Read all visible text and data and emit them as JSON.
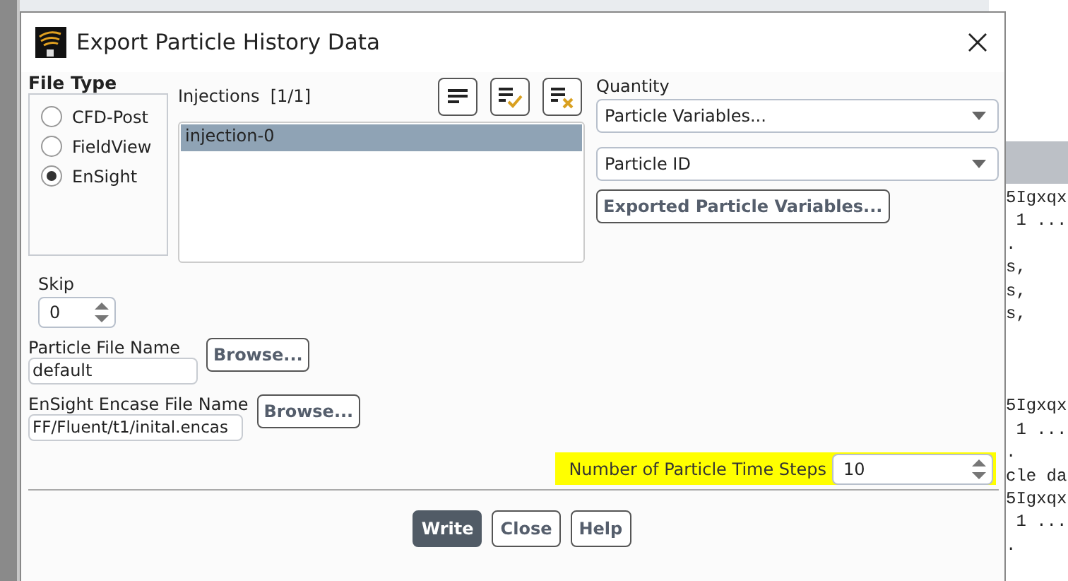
{
  "window": {
    "title": "Export Particle History Data"
  },
  "file_type": {
    "label": "File Type",
    "options": [
      {
        "label": "CFD-Post",
        "selected": false
      },
      {
        "label": "FieldView",
        "selected": false
      },
      {
        "label": "EnSight",
        "selected": true
      }
    ]
  },
  "injections": {
    "label": "Injections",
    "count": "[1/1]",
    "items": [
      {
        "label": "injection-0",
        "selected": true
      }
    ]
  },
  "quantity": {
    "label": "Quantity",
    "dropdowns": [
      {
        "value": "Particle Variables..."
      },
      {
        "value": "Particle ID"
      }
    ],
    "button": "Exported Particle Variables..."
  },
  "skip": {
    "label": "Skip",
    "value": "0"
  },
  "particle_file": {
    "label": "Particle File Name",
    "value": "default",
    "button": "Browse..."
  },
  "encase_file": {
    "label": "EnSight Encase File Name",
    "value": "FF/Fluent/t1/inital.encas",
    "button": "Browse..."
  },
  "time_steps": {
    "label": "Number of Particle Time Steps",
    "value": "10",
    "highlighted": true
  },
  "buttons": [
    {
      "label": "Write",
      "primary": true
    },
    {
      "label": "Close",
      "primary": false
    },
    {
      "label": "Help",
      "primary": false
    }
  ],
  "background_console": {
    "blocks": [
      [
        "5Igxqx",
        " 1 ...",
        ".",
        "s,",
        "s,",
        "s,"
      ],
      [
        "5Igxqx",
        " 1 ...",
        ".",
        "cle da",
        "5Igxqx",
        " 1 ...",
        "."
      ]
    ]
  }
}
